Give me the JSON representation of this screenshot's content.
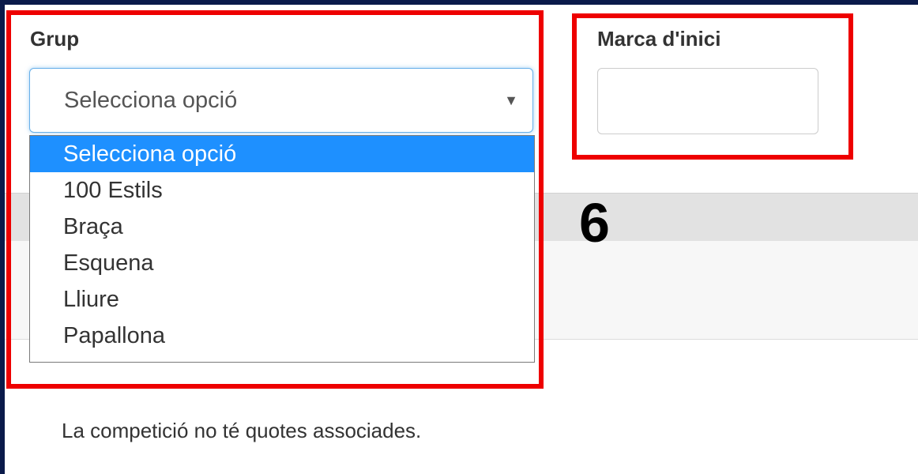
{
  "form": {
    "group": {
      "label": "Grup",
      "selected_value": "Selecciona opció",
      "arrow_icon": "triangle-down-icon",
      "options": [
        "Selecciona opció",
        "100 Estils",
        "Braça",
        "Esquena",
        "Lliure",
        "Papallona"
      ],
      "highlighted_index": 0
    },
    "start_mark": {
      "label": "Marca d'inici",
      "value": ""
    }
  },
  "annotation": {
    "step_number": "6",
    "highlight_color": "#ee0000"
  },
  "message": "La competició no té quotes associades."
}
